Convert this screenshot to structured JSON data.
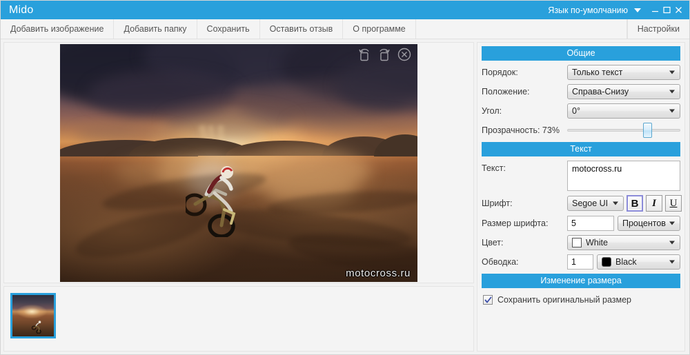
{
  "titlebar": {
    "app_title": "Mido",
    "language_label": "Язык по-умолчанию",
    "minimize": "—",
    "maximize": "□",
    "close": "✕",
    "accent_color": "#29a0dc"
  },
  "toolbar": {
    "add_image": "Добавить изображение",
    "add_folder": "Добавить папку",
    "save": "Сохранить",
    "feedback": "Оставить отзыв",
    "about": "О программе",
    "settings": "Настройки"
  },
  "preview": {
    "watermark_text": "motocross.ru",
    "rotate_left_title": "rotate-left",
    "rotate_right_title": "rotate-right",
    "remove_title": "remove"
  },
  "thumbnails": {
    "items": [
      {
        "label": "motocross-thumbnail",
        "selected": true
      }
    ]
  },
  "panel": {
    "general": {
      "header": "Общие",
      "order_label": "Порядок:",
      "order_value": "Только текст",
      "position_label": "Положение:",
      "position_value": "Справа-Снизу",
      "angle_label": "Угол:",
      "angle_value": "0°",
      "transparency_label": "Прозрачность: 73%",
      "transparency_value": 73
    },
    "text": {
      "header": "Текст",
      "text_label": "Текст:",
      "text_value": "motocross.ru",
      "font_label": "Шрифт:",
      "font_value": "Segoe UI",
      "bold_label": "B",
      "italic_label": "I",
      "underline_label": "U",
      "bold_active": true,
      "size_label": "Размер шрифта:",
      "size_value": "5",
      "size_unit": "Процентов",
      "color_label": "Цвет:",
      "color_value": "White",
      "color_hex": "#ffffff",
      "outline_label": "Обводка:",
      "outline_width": "1",
      "outline_color": "Black",
      "outline_hex": "#000000"
    },
    "resize": {
      "header": "Изменение размера",
      "keep_original_label": "Сохранить оригинальный размер",
      "keep_original_checked": true
    }
  }
}
